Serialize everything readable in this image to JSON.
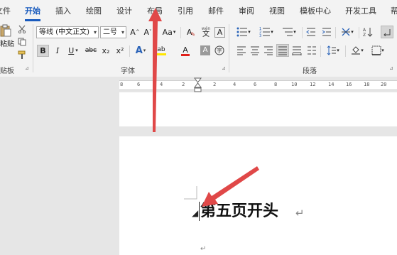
{
  "tabs": [
    {
      "label": "文件"
    },
    {
      "label": "开始"
    },
    {
      "label": "插入"
    },
    {
      "label": "绘图"
    },
    {
      "label": "设计"
    },
    {
      "label": "布局"
    },
    {
      "label": "引用"
    },
    {
      "label": "邮件"
    },
    {
      "label": "审阅"
    },
    {
      "label": "视图"
    },
    {
      "label": "模板中心"
    },
    {
      "label": "开发工具"
    },
    {
      "label": "帮"
    }
  ],
  "clipboard": {
    "paste_label": "粘贴",
    "group_label": "贴板"
  },
  "font": {
    "name": "等线 (中文正文)",
    "size": "二号",
    "group_label": "字体",
    "bold": "B",
    "italic": "I",
    "underline": "U",
    "strike": "abc",
    "subscript": "x₂",
    "superscript": "x²",
    "grow": "A^",
    "shrink": "A˅",
    "case": "Aa",
    "text_effects": "A",
    "font_color": "A",
    "shading": "A",
    "clear_format": "A",
    "phonetic": "wén",
    "char_border": "A",
    "highlight": "ab"
  },
  "paragraph": {
    "group_label": "段落"
  },
  "ruler": {
    "ticks": [
      "8",
      "6",
      "4",
      "2",
      "2",
      "4",
      "6",
      "8",
      "10",
      "12",
      "14",
      "16",
      "18",
      "20",
      "22"
    ]
  },
  "document": {
    "heading": "第五页开头",
    "paragraph_mark": "↵"
  },
  "colors": {
    "accent": "#185abd",
    "arrow": "#e04848"
  }
}
